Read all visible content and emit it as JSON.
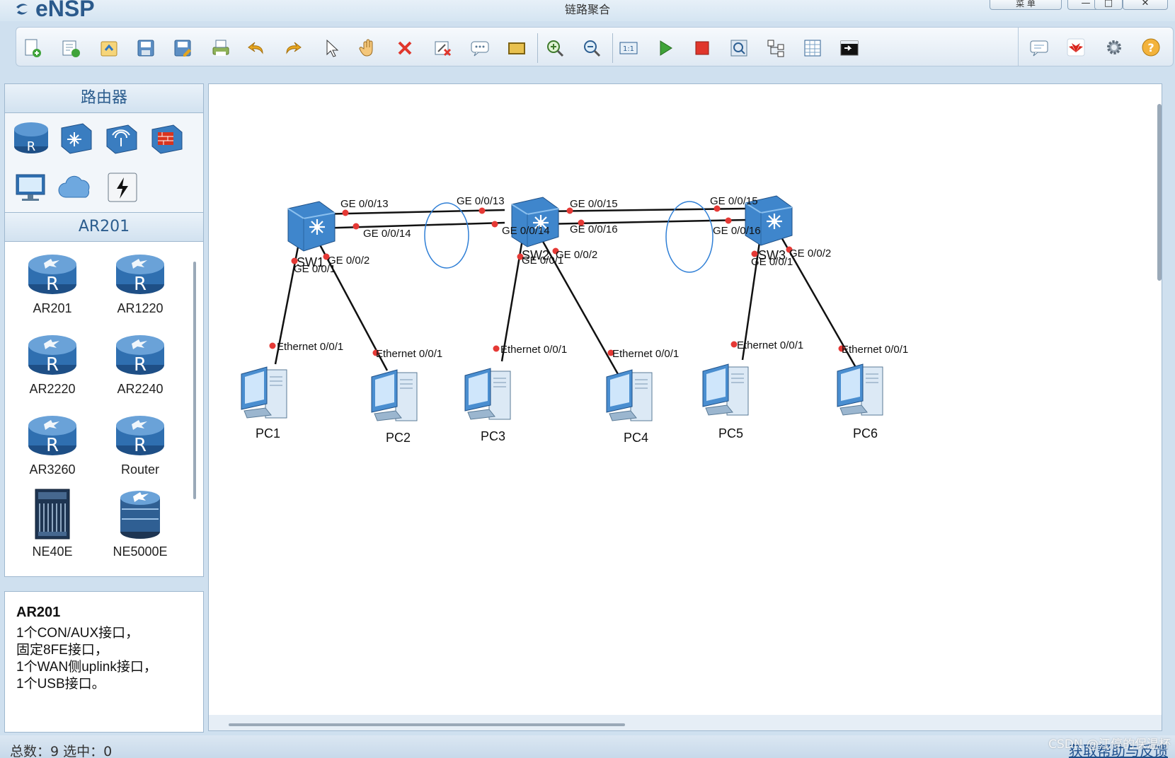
{
  "app": {
    "name": "eNSP",
    "window_title": "链路聚合",
    "menu_label": "菜 单"
  },
  "toolbar": {
    "buttons": [
      "new-topology",
      "new-example",
      "open",
      "save",
      "save-as",
      "print",
      "undo",
      "redo",
      "select",
      "pan",
      "delete",
      "delete-connections",
      "text",
      "palette",
      "zoom-in",
      "zoom-out",
      "fit",
      "start-device",
      "stop-device",
      "capture",
      "show-grid",
      "topology-view",
      "command-line"
    ],
    "right_buttons": [
      "forum",
      "huawei",
      "settings",
      "help"
    ]
  },
  "left_panel": {
    "category_title": "路由器",
    "subcategory_title": "AR201",
    "devices": [
      {
        "label": "AR201"
      },
      {
        "label": "AR1220"
      },
      {
        "label": "AR2220"
      },
      {
        "label": "AR2240"
      },
      {
        "label": "AR3260"
      },
      {
        "label": "Router"
      },
      {
        "label": "NE40E"
      },
      {
        "label": "NE5000E"
      }
    ],
    "description": {
      "title": "AR201",
      "lines": [
        "1个CON/AUX接口，",
        "固定8FE接口，",
        "1个WAN侧uplink接口，",
        "1个USB接口。"
      ]
    }
  },
  "topology": {
    "switches": [
      {
        "name": "SW1"
      },
      {
        "name": "SW2"
      },
      {
        "name": "SW3"
      }
    ],
    "pcs": [
      {
        "name": "PC1"
      },
      {
        "name": "PC2"
      },
      {
        "name": "PC3"
      },
      {
        "name": "PC4"
      },
      {
        "name": "PC5"
      },
      {
        "name": "PC6"
      }
    ],
    "port_labels": {
      "sw1_13": "GE 0/0/13",
      "sw1_14": "GE 0/0/14",
      "sw2_13": "GE 0/0/13",
      "sw2_14": "GE 0/0/14",
      "sw2_15": "GE 0/0/15",
      "sw2_16": "GE 0/0/16",
      "sw3_15": "GE 0/0/15",
      "sw3_16": "GE 0/0/16",
      "sw1_1": "GE 0/0/1",
      "sw1_2": "GE 0/0/2",
      "sw2_1": "GE 0/0/1",
      "sw2_2": "GE 0/0/2",
      "sw3_1": "GE 0/0/1",
      "sw3_2": "GE 0/0/2",
      "pc_eth": "Ethernet 0/0/1"
    },
    "colors": {
      "link": "#111111",
      "port_dot": "#e53935",
      "agg_ellipse": "#2f7fd6"
    }
  },
  "status_bar": {
    "summary": "总数：9  选中：0",
    "help_link": "获取帮助与反馈",
    "watermark": "CSDN @江停的保温杯"
  }
}
